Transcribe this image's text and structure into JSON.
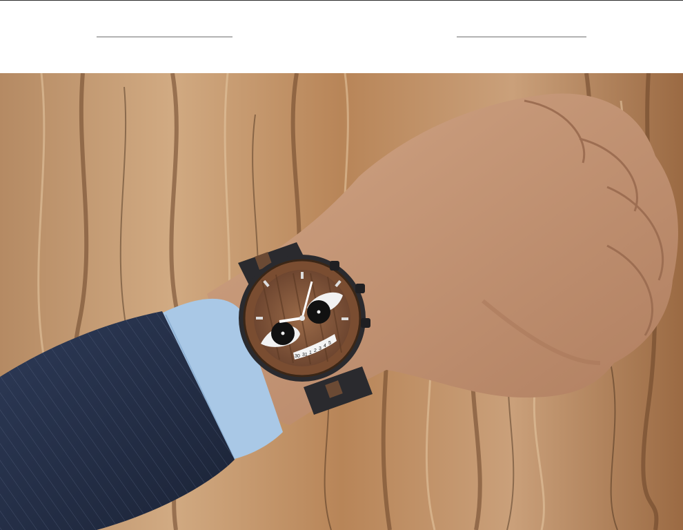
{
  "page": {
    "background": "#ffffff"
  },
  "header": {
    "divider_color": "#6f6f6f"
  },
  "photo": {
    "subject": "wrist-watch-on-hand-against-tree-bark",
    "colors": {
      "bark_light": "#c9a27a",
      "bark_mid": "#a0704a",
      "bark_dark": "#5a3a22",
      "skin": "#c99a78",
      "skin_shadow": "#a87658",
      "sleeve": "#25304a",
      "shirt_cuff": "#a9c8e6",
      "watch_case": "#2a2a2e",
      "watch_dial_wood": "#8a5a3a"
    },
    "watch_date_window": {
      "digits": [
        "30",
        "31",
        "1",
        "2",
        "3",
        "4",
        "5"
      ]
    }
  }
}
